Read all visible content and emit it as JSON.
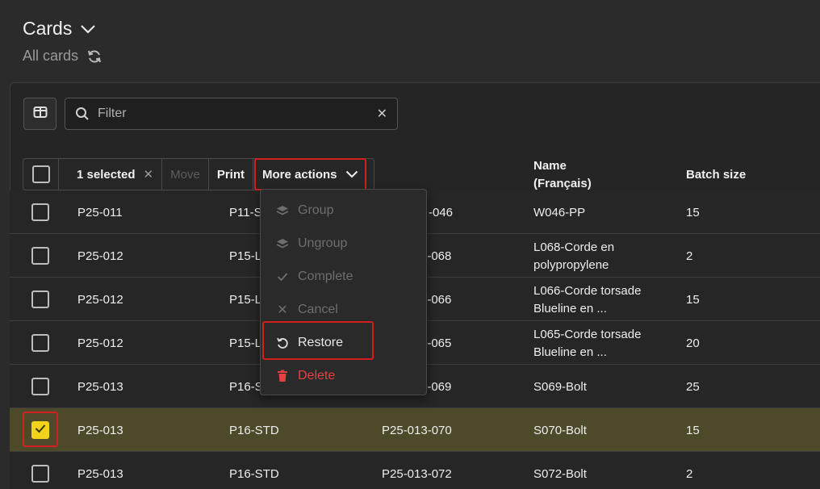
{
  "header": {
    "title": "Cards",
    "subtitle": "All cards"
  },
  "filter": {
    "placeholder": "Filter",
    "value": ""
  },
  "selection": {
    "count_label": "1 selected",
    "move_label": "Move",
    "print_label": "Print",
    "more_actions_label": "More actions"
  },
  "columns": {
    "name": "Name\n(Français)",
    "batch": "Batch size"
  },
  "menu": {
    "group": "Group",
    "ungroup": "Ungroup",
    "complete": "Complete",
    "cancel": "Cancel",
    "restore": "Restore",
    "delete": "Delete"
  },
  "rows": [
    {
      "c1": "P25-011",
      "c2": "P11-S",
      "c3": "-046",
      "name": "W046-PP",
      "batch": "15",
      "checked": false
    },
    {
      "c1": "P25-012",
      "c2": "P15-L",
      "c3": "2-068",
      "name": "L068-Corde en polypropylene",
      "batch": "2",
      "checked": false
    },
    {
      "c1": "P25-012",
      "c2": "P15-L",
      "c3": "2-066",
      "name": "L066-Corde torsade Blueline en ...",
      "batch": "15",
      "checked": false
    },
    {
      "c1": "P25-012",
      "c2": "P15-L",
      "c3": "2-065",
      "name": "L065-Corde torsade Blueline en ...",
      "batch": "20",
      "checked": false
    },
    {
      "c1": "P25-013",
      "c2": "P16-S",
      "c3": "3-069",
      "name": "S069-Bolt",
      "batch": "25",
      "checked": false
    },
    {
      "c1": "P25-013",
      "c2": "P16-STD",
      "c3": "P25-013-070",
      "name": "S070-Bolt",
      "batch": "15",
      "checked": true
    },
    {
      "c1": "P25-013",
      "c2": "P16-STD",
      "c3": "P25-013-072",
      "name": "S072-Bolt",
      "batch": "2",
      "checked": false
    }
  ],
  "colors": {
    "accent_highlight": "#d21f1f",
    "checked": "#f2d21a",
    "danger": "#e74040"
  }
}
